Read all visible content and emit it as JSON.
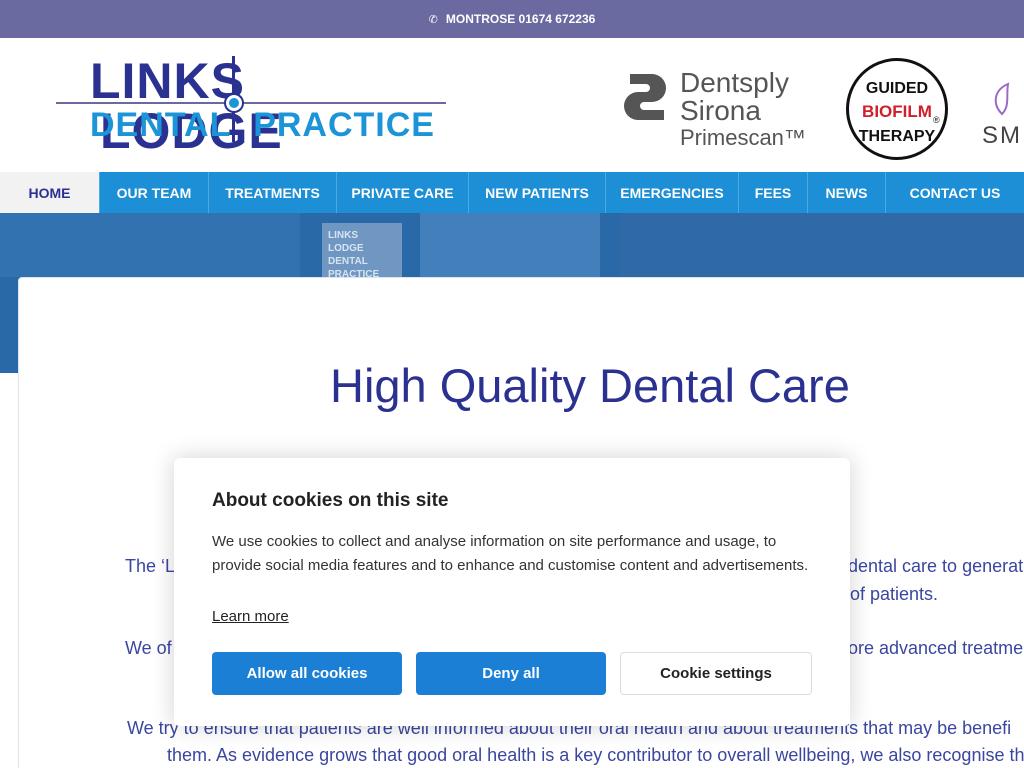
{
  "topbar": {
    "phone_icon": "phone-icon",
    "phone_text": "MONTROSE 01674 672236"
  },
  "logo": {
    "line1_left": "LINKS",
    "line1_right": "LODGE",
    "line2_left": "DENTAL",
    "line2_right": "PRACTICE"
  },
  "partners": {
    "dentsply": {
      "line1": "Dentsply",
      "line2": "Sirona",
      "line3": "Primescan™"
    },
    "gbt": {
      "top": "GUIDED",
      "middle": "BIOFILM",
      "bottom": "THERAPY",
      "registered": "®"
    },
    "smile": {
      "text": "SM"
    }
  },
  "nav": {
    "items": [
      {
        "label": "HOME"
      },
      {
        "label": "OUR TEAM"
      },
      {
        "label": "TREATMENTS"
      },
      {
        "label": "PRIVATE CARE"
      },
      {
        "label": "NEW PATIENTS"
      },
      {
        "label": "EMERGENCIES"
      },
      {
        "label": "FEES"
      },
      {
        "label": "NEWS"
      },
      {
        "label": "CONTACT US"
      }
    ]
  },
  "hero": {
    "sign_line1": "LINKS LODGE",
    "sign_line2": "DENTAL PRACTICE"
  },
  "main": {
    "title": "High Quality Dental Care",
    "para1_left": "The ‘L",
    "para1_right": "dental care to generati",
    "para1_right2": "of patients.",
    "para2_left": "We of",
    "para2_right": "ore advanced treatme",
    "para3_line1": "We try to ensure that patients are well informed about their oral health and about treatments that may be benefi",
    "para3_line2": "them. As evidence grows that good oral health is a key contributor to overall wellbeing, we also recognise th"
  },
  "cookie": {
    "heading": "About cookies on this site",
    "body": "We use cookies to collect and analyse information on site performance and usage, to provide social media features and to enhance and customise content and advertisements.",
    "learn_more": "Learn more",
    "allow_label": "Allow all cookies",
    "deny_label": "Deny all",
    "settings_label": "Cookie settings"
  },
  "colors": {
    "topbar": "#6a6aa0",
    "nav": "#1c8fd6",
    "brand_navy": "#2a3190",
    "brand_blue": "#1c94d8",
    "button_blue": "#1c7fd6"
  }
}
